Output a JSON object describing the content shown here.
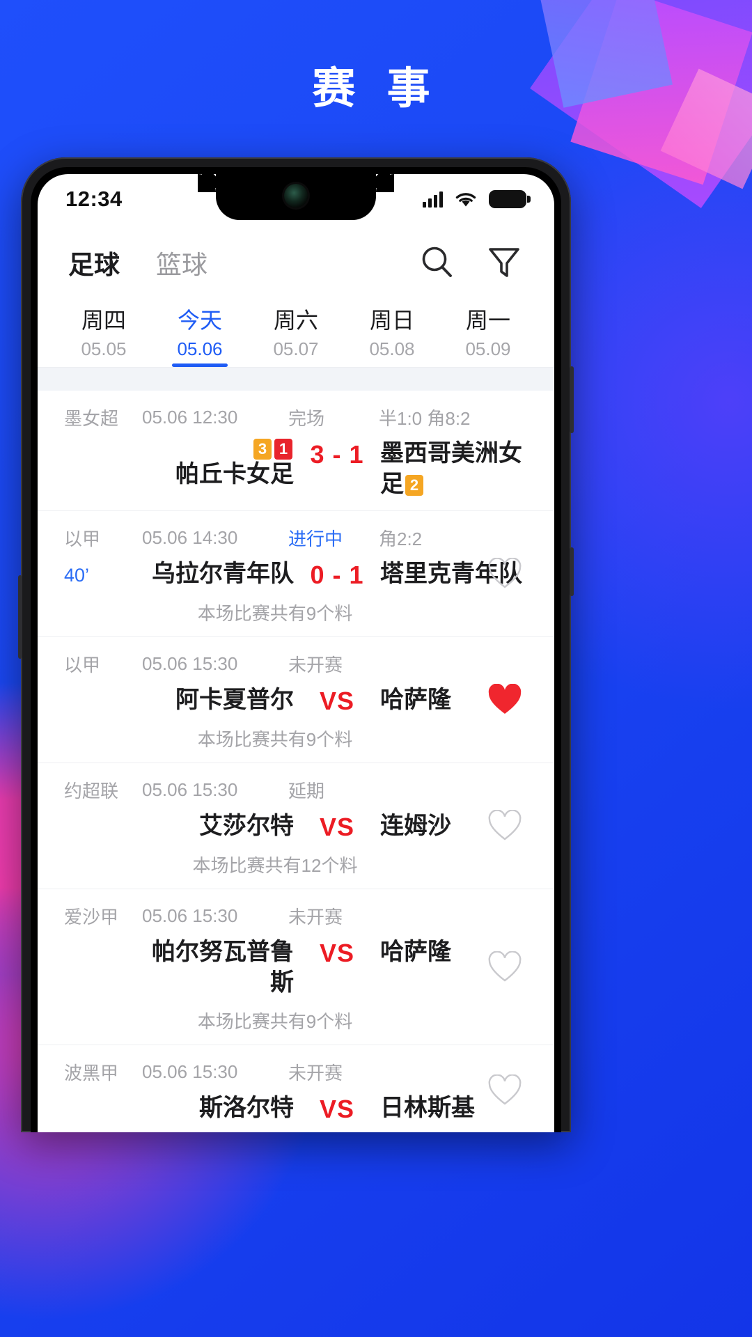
{
  "page": {
    "title": "赛 事"
  },
  "status_bar": {
    "time": "12:34",
    "icons": [
      "signal-icon",
      "wifi-icon",
      "battery-icon"
    ]
  },
  "top_nav": {
    "sports": [
      {
        "label": "足球",
        "active": true
      },
      {
        "label": "篮球",
        "active": false
      }
    ],
    "icons": [
      {
        "name": "search-icon"
      },
      {
        "name": "filter-icon"
      }
    ]
  },
  "date_tabs": [
    {
      "day": "周四",
      "date": "05.05",
      "active": false
    },
    {
      "day": "今天",
      "date": "05.06",
      "active": true
    },
    {
      "day": "周六",
      "date": "05.07",
      "active": false
    },
    {
      "day": "周日",
      "date": "05.08",
      "active": false
    },
    {
      "day": "周一",
      "date": "05.09",
      "active": false
    }
  ],
  "matches": [
    {
      "league": "墨女超",
      "time": "05.06 12:30",
      "status": "完场",
      "status_live": false,
      "extra": "半1:0 角8:2",
      "minute": "",
      "home": "帕丘卡女足",
      "home_badges": [
        {
          "text": "3",
          "color": "orange"
        },
        {
          "text": "1",
          "color": "red"
        }
      ],
      "score": "3 - 1",
      "away": "墨西哥美洲女足",
      "away_badges": [
        {
          "text": "2",
          "color": "orange"
        }
      ],
      "note": "",
      "fav": "none"
    },
    {
      "league": "以甲",
      "time": "05.06 14:30",
      "status": "进行中",
      "status_live": true,
      "extra": "角2:2",
      "minute": "40’",
      "home": "乌拉尔青年队",
      "home_badges": [],
      "score": "0 - 1",
      "away": "塔里克青年队",
      "away_badges": [],
      "note": "本场比赛共有9个料",
      "fav": "outline"
    },
    {
      "league": "以甲",
      "time": "05.06 15:30",
      "status": "未开赛",
      "status_live": false,
      "extra": "",
      "minute": "",
      "home": "阿卡夏普尔",
      "home_badges": [],
      "score": "VS",
      "away": "哈萨隆",
      "away_badges": [],
      "note": "本场比赛共有9个料",
      "fav": "filled"
    },
    {
      "league": "约超联",
      "time": "05.06 15:30",
      "status": "延期",
      "status_live": false,
      "extra": "",
      "minute": "",
      "home": "艾莎尔特",
      "home_badges": [],
      "score": "VS",
      "away": "连姆沙",
      "away_badges": [],
      "note": "本场比赛共有12个料",
      "fav": "outline"
    },
    {
      "league": "爱沙甲",
      "time": "05.06 15:30",
      "status": "未开赛",
      "status_live": false,
      "extra": "",
      "minute": "",
      "home": "帕尔努瓦普鲁斯",
      "home_badges": [],
      "score": "VS",
      "away": "哈萨隆",
      "away_badges": [],
      "note": "本场比赛共有9个料",
      "fav": "outline"
    },
    {
      "league": "波黑甲",
      "time": "05.06 15:30",
      "status": "未开赛",
      "status_live": false,
      "extra": "",
      "minute": "",
      "home": "斯洛尔特",
      "home_badges": [],
      "score": "VS",
      "away": "日林斯基",
      "away_badges": [],
      "note": "",
      "fav": "outline"
    }
  ],
  "colors": {
    "brand_blue": "#1f5cf5",
    "score_red": "#ec1c24",
    "badge_orange": "#f5a623",
    "badge_red": "#e8242c",
    "fav_red": "#f0262e",
    "muted": "#a4a4a8"
  }
}
